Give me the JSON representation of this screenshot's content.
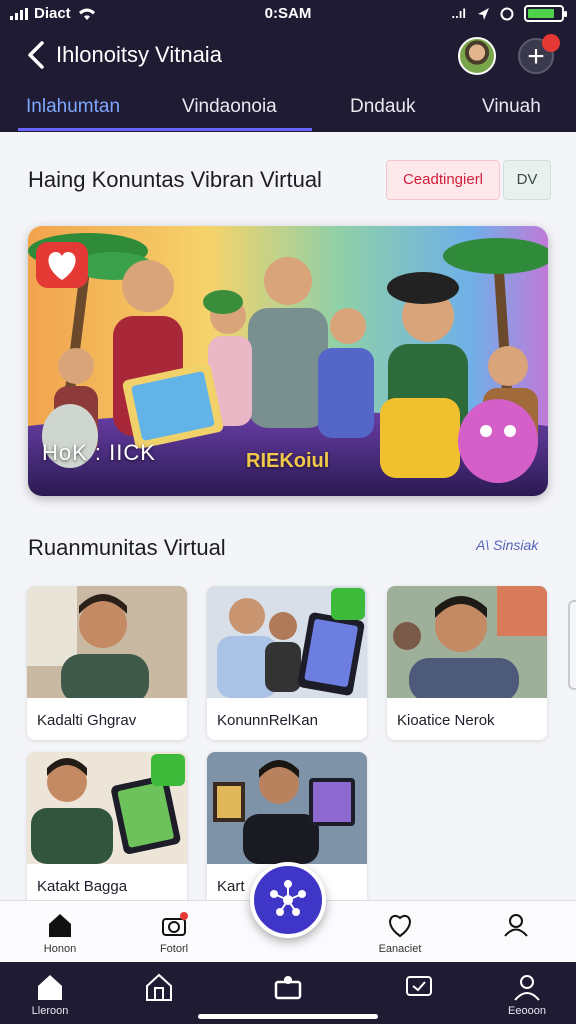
{
  "status_bar": {
    "carrier": "Diact",
    "time": "0:SAM"
  },
  "header": {
    "title": "Ihlonoitsy Vitnaia"
  },
  "tabs": [
    {
      "label": "Inlahumtan",
      "active": true
    },
    {
      "label": "Vindaonoia",
      "active": false
    },
    {
      "label": "Dndauk",
      "active": false
    },
    {
      "label": "Vinuah",
      "active": false
    }
  ],
  "section1": {
    "title": "Haing Konuntas Vibran Virtual",
    "pill_primary": "Ceadtingierl",
    "pill_secondary": "DV",
    "hero": {
      "caption_left": "HoK : IICK",
      "caption_mid": "RIEKoiul"
    }
  },
  "section2": {
    "title": "Ruanmunitas Virtual",
    "see_all": "A\\ Sinsiak",
    "cards": [
      {
        "label": "Kadalti Ghgrav"
      },
      {
        "label": "KonunnRelKan"
      },
      {
        "label": "Kioatice Nerok"
      },
      {
        "label": "Katakt Bagga"
      },
      {
        "label": "Kart"
      }
    ]
  },
  "bottom_nav": [
    {
      "label": "Honon",
      "icon": "home-icon"
    },
    {
      "label": "Fotorl",
      "icon": "camera-icon"
    },
    {
      "label": "Eanaciet",
      "icon": "heart-shield-icon"
    },
    {
      "label": "",
      "icon": "profile-icon"
    }
  ],
  "bottom_nav2": [
    {
      "label": "Lleroon",
      "icon": "home-icon"
    },
    {
      "label": "",
      "icon": "store-icon"
    },
    {
      "label": "",
      "icon": "inbox-icon"
    },
    {
      "label": "",
      "icon": "tv-icon"
    },
    {
      "label": "Eeooon",
      "icon": "user-icon"
    }
  ],
  "colors": {
    "header_bg": "#1f1b33",
    "accent": "#3f36c8",
    "tab_active": "#7ea6ff",
    "badge": "#e53935",
    "chip": "#3dba3a"
  }
}
